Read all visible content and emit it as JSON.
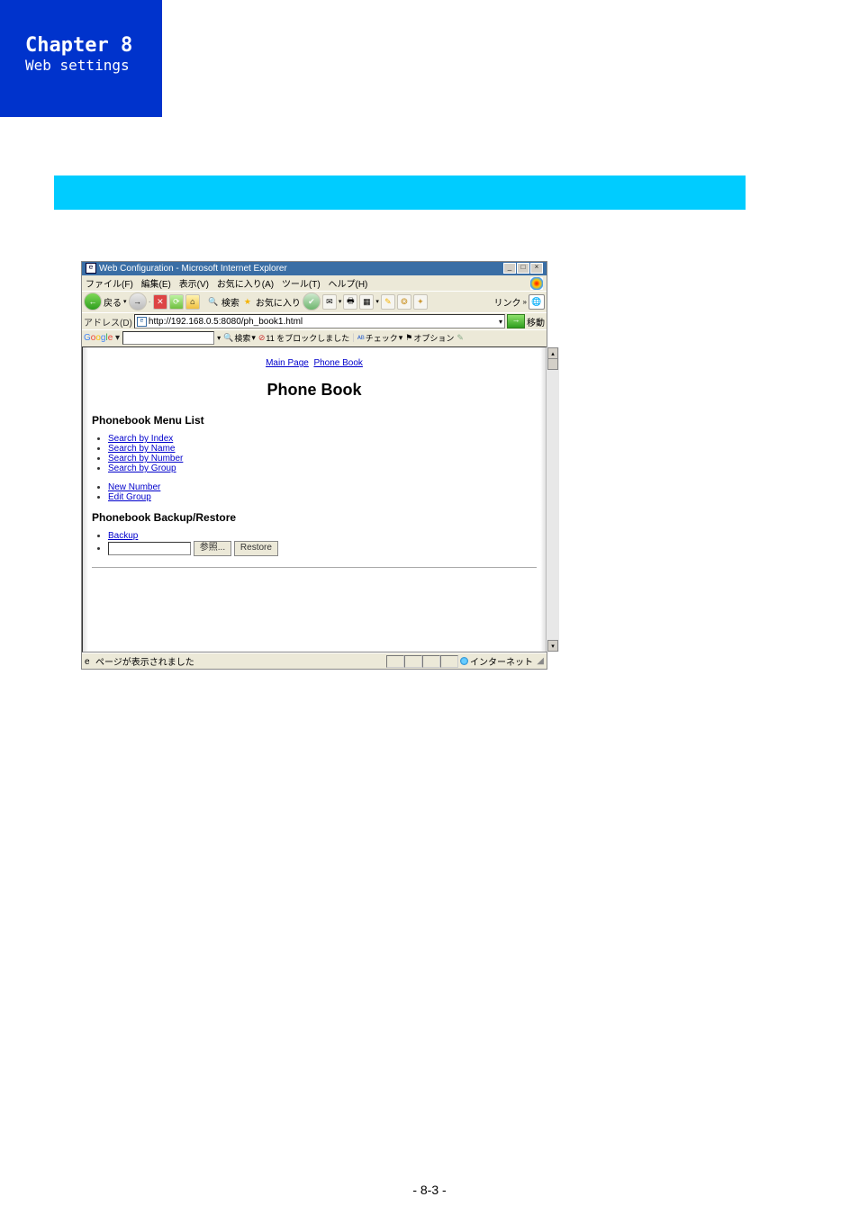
{
  "doc": {
    "chapter_title": "Chapter 8",
    "chapter_subtitle": "Web settings",
    "page_number": "- 8-3 -"
  },
  "ie": {
    "window_title": "Web Configuration - Microsoft Internet Explorer",
    "menus": {
      "file": "ファイル(F)",
      "edit": "編集(E)",
      "view": "表示(V)",
      "fav": "お気に入り(A)",
      "tools": "ツール(T)",
      "help": "ヘルプ(H)"
    },
    "toolbar": {
      "back": "戻る",
      "search_label": "検索",
      "fav_btn": "お気に入り",
      "links": "リンク"
    },
    "address": {
      "label": "アドレス(D)",
      "url": "http://192.168.0.5:8080/ph_book1.html",
      "go": "移動"
    },
    "google": {
      "brand": "Google",
      "search_btn": "検索",
      "blocked": "11 をブロックしました",
      "check": "チェック",
      "options": "オプション"
    },
    "status": {
      "left": "ページが表示されました",
      "right": "インターネット"
    }
  },
  "page": {
    "breadcrumb": {
      "main": "Main Page",
      "phonebook": "Phone Book"
    },
    "h1": "Phone Book",
    "menu_h": "Phonebook Menu List",
    "menu": {
      "index": "Search by Index",
      "name": "Search by Name",
      "number": "Search by Number",
      "group": "Search by Group",
      "newnum": "New Number",
      "editgroup": "Edit Group"
    },
    "backup_h": "Phonebook Backup/Restore",
    "backup_link": "Backup",
    "browse_btn": "参照...",
    "restore_btn": "Restore"
  }
}
